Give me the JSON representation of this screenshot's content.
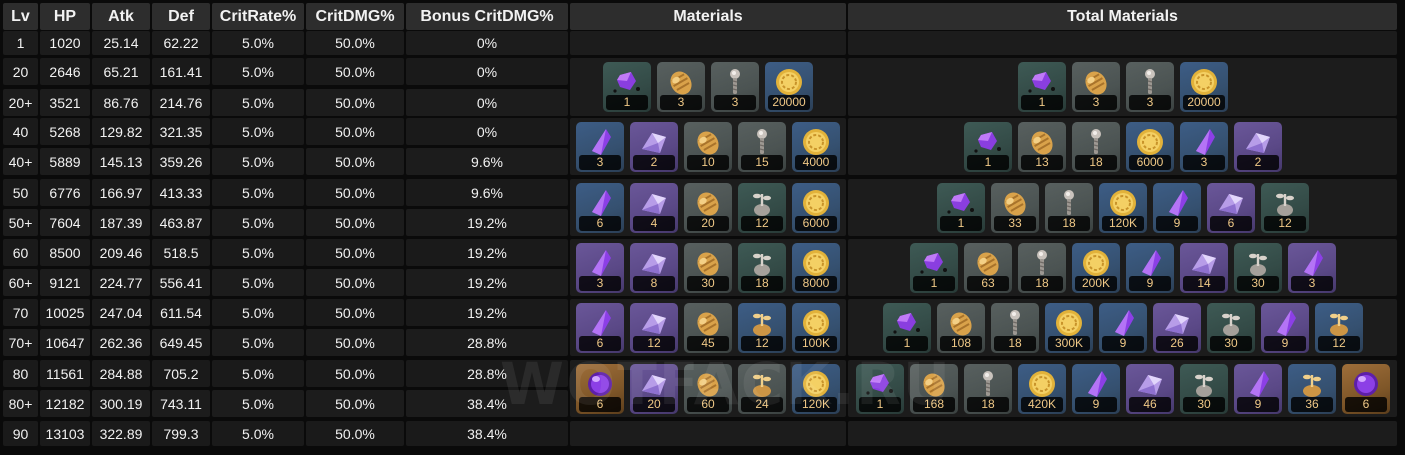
{
  "headers": {
    "lv": "Lv",
    "hp": "HP",
    "atk": "Atk",
    "def": "Def",
    "crit_rate": "CritRate%",
    "crit_dmg": "CritDMG%",
    "bonus_crit_dmg": "Bonus CritDMG%",
    "materials": "Materials",
    "total_materials": "Total Materials"
  },
  "rows": [
    {
      "lv": "1",
      "hp": "1020",
      "atk": "25.14",
      "def": "62.22",
      "crit_rate": "5.0%",
      "crit_dmg": "50.0%",
      "bonus": "0%"
    },
    {
      "lv": "20",
      "hp": "2646",
      "atk": "65.21",
      "def": "161.41",
      "crit_rate": "5.0%",
      "crit_dmg": "50.0%",
      "bonus": "0%"
    },
    {
      "lv": "20+",
      "hp": "3521",
      "atk": "86.76",
      "def": "214.76",
      "crit_rate": "5.0%",
      "crit_dmg": "50.0%",
      "bonus": "0%"
    },
    {
      "lv": "40",
      "hp": "5268",
      "atk": "129.82",
      "def": "321.35",
      "crit_rate": "5.0%",
      "crit_dmg": "50.0%",
      "bonus": "0%"
    },
    {
      "lv": "40+",
      "hp": "5889",
      "atk": "145.13",
      "def": "359.26",
      "crit_rate": "5.0%",
      "crit_dmg": "50.0%",
      "bonus": "9.6%"
    },
    {
      "lv": "50",
      "hp": "6776",
      "atk": "166.97",
      "def": "413.33",
      "crit_rate": "5.0%",
      "crit_dmg": "50.0%",
      "bonus": "9.6%"
    },
    {
      "lv": "50+",
      "hp": "7604",
      "atk": "187.39",
      "def": "463.87",
      "crit_rate": "5.0%",
      "crit_dmg": "50.0%",
      "bonus": "19.2%"
    },
    {
      "lv": "60",
      "hp": "8500",
      "atk": "209.46",
      "def": "518.5",
      "crit_rate": "5.0%",
      "crit_dmg": "50.0%",
      "bonus": "19.2%"
    },
    {
      "lv": "60+",
      "hp": "9121",
      "atk": "224.77",
      "def": "556.41",
      "crit_rate": "5.0%",
      "crit_dmg": "50.0%",
      "bonus": "19.2%"
    },
    {
      "lv": "70",
      "hp": "10025",
      "atk": "247.04",
      "def": "611.54",
      "crit_rate": "5.0%",
      "crit_dmg": "50.0%",
      "bonus": "19.2%"
    },
    {
      "lv": "70+",
      "hp": "10647",
      "atk": "262.36",
      "def": "649.45",
      "crit_rate": "5.0%",
      "crit_dmg": "50.0%",
      "bonus": "28.8%"
    },
    {
      "lv": "80",
      "hp": "11561",
      "atk": "284.88",
      "def": "705.2",
      "crit_rate": "5.0%",
      "crit_dmg": "50.0%",
      "bonus": "28.8%"
    },
    {
      "lv": "80+",
      "hp": "12182",
      "atk": "300.19",
      "def": "743.11",
      "crit_rate": "5.0%",
      "crit_dmg": "50.0%",
      "bonus": "38.4%"
    },
    {
      "lv": "90",
      "hp": "13103",
      "atk": "322.89",
      "def": "799.3",
      "crit_rate": "5.0%",
      "crit_dmg": "50.0%",
      "bonus": "38.4%"
    }
  ],
  "materials": [
    [
      {
        "icon": "purple-crystal-chip-icon",
        "qty": "1",
        "bg": "green"
      },
      {
        "icon": "golden-pine-cone-icon",
        "qty": "3",
        "bg": "grey"
      },
      {
        "icon": "silver-bolt-icon",
        "qty": "3",
        "bg": "grey"
      },
      {
        "icon": "gold-coin-icon",
        "qty": "20000",
        "bg": "blue"
      }
    ],
    [
      {
        "icon": "purple-shard-icon",
        "qty": "3",
        "bg": "blue"
      },
      {
        "icon": "purple-fragment-icon",
        "qty": "2",
        "bg": "purple"
      },
      {
        "icon": "golden-pine-cone-icon",
        "qty": "10",
        "bg": "grey"
      },
      {
        "icon": "silver-bolt-icon",
        "qty": "15",
        "bg": "grey"
      },
      {
        "icon": "gold-coin-icon",
        "qty": "4000",
        "bg": "blue"
      }
    ],
    [
      {
        "icon": "purple-shard-icon",
        "qty": "6",
        "bg": "blue"
      },
      {
        "icon": "purple-fragment-icon",
        "qty": "4",
        "bg": "purple"
      },
      {
        "icon": "golden-pine-cone-icon",
        "qty": "20",
        "bg": "grey"
      },
      {
        "icon": "silver-sprout-icon",
        "qty": "12",
        "bg": "green"
      },
      {
        "icon": "gold-coin-icon",
        "qty": "6000",
        "bg": "blue"
      }
    ],
    [
      {
        "icon": "purple-shard-icon",
        "qty": "3",
        "bg": "purple"
      },
      {
        "icon": "purple-fragment-icon",
        "qty": "8",
        "bg": "purple"
      },
      {
        "icon": "golden-pine-cone-icon",
        "qty": "30",
        "bg": "grey"
      },
      {
        "icon": "silver-sprout-icon",
        "qty": "18",
        "bg": "green"
      },
      {
        "icon": "gold-coin-icon",
        "qty": "8000",
        "bg": "blue"
      }
    ],
    [
      {
        "icon": "purple-shard-icon",
        "qty": "6",
        "bg": "purple"
      },
      {
        "icon": "purple-fragment-icon",
        "qty": "12",
        "bg": "purple"
      },
      {
        "icon": "golden-pine-cone-icon",
        "qty": "45",
        "bg": "grey"
      },
      {
        "icon": "golden-sprout-icon",
        "qty": "12",
        "bg": "blue"
      },
      {
        "icon": "gold-coin-icon",
        "qty": "100K",
        "bg": "blue"
      }
    ],
    [
      {
        "icon": "purple-gem-icon",
        "qty": "6",
        "bg": "orange"
      },
      {
        "icon": "purple-fragment-icon",
        "qty": "20",
        "bg": "purple"
      },
      {
        "icon": "golden-pine-cone-icon",
        "qty": "60",
        "bg": "grey"
      },
      {
        "icon": "golden-sprout-icon",
        "qty": "24",
        "bg": "grey"
      },
      {
        "icon": "gold-coin-icon",
        "qty": "120K",
        "bg": "blue"
      }
    ]
  ],
  "total_materials": [
    [
      {
        "icon": "purple-crystal-chip-icon",
        "qty": "1",
        "bg": "green"
      },
      {
        "icon": "golden-pine-cone-icon",
        "qty": "3",
        "bg": "grey"
      },
      {
        "icon": "silver-bolt-icon",
        "qty": "3",
        "bg": "grey"
      },
      {
        "icon": "gold-coin-icon",
        "qty": "20000",
        "bg": "blue"
      }
    ],
    [
      {
        "icon": "purple-crystal-chip-icon",
        "qty": "1",
        "bg": "green"
      },
      {
        "icon": "golden-pine-cone-icon",
        "qty": "13",
        "bg": "grey"
      },
      {
        "icon": "silver-bolt-icon",
        "qty": "18",
        "bg": "grey"
      },
      {
        "icon": "gold-coin-icon",
        "qty": "6000",
        "bg": "blue"
      },
      {
        "icon": "purple-shard-icon",
        "qty": "3",
        "bg": "blue"
      },
      {
        "icon": "purple-fragment-icon",
        "qty": "2",
        "bg": "purple"
      }
    ],
    [
      {
        "icon": "purple-crystal-chip-icon",
        "qty": "1",
        "bg": "green"
      },
      {
        "icon": "golden-pine-cone-icon",
        "qty": "33",
        "bg": "grey"
      },
      {
        "icon": "silver-bolt-icon",
        "qty": "18",
        "bg": "grey"
      },
      {
        "icon": "gold-coin-icon",
        "qty": "120K",
        "bg": "blue"
      },
      {
        "icon": "purple-shard-icon",
        "qty": "9",
        "bg": "blue"
      },
      {
        "icon": "purple-fragment-icon",
        "qty": "6",
        "bg": "purple"
      },
      {
        "icon": "silver-sprout-icon",
        "qty": "12",
        "bg": "green"
      }
    ],
    [
      {
        "icon": "purple-crystal-chip-icon",
        "qty": "1",
        "bg": "green"
      },
      {
        "icon": "golden-pine-cone-icon",
        "qty": "63",
        "bg": "grey"
      },
      {
        "icon": "silver-bolt-icon",
        "qty": "18",
        "bg": "grey"
      },
      {
        "icon": "gold-coin-icon",
        "qty": "200K",
        "bg": "blue"
      },
      {
        "icon": "purple-shard-icon",
        "qty": "9",
        "bg": "blue"
      },
      {
        "icon": "purple-fragment-icon",
        "qty": "14",
        "bg": "purple"
      },
      {
        "icon": "silver-sprout-icon",
        "qty": "30",
        "bg": "green"
      },
      {
        "icon": "purple-shard-icon",
        "qty": "3",
        "bg": "purple"
      }
    ],
    [
      {
        "icon": "purple-crystal-chip-icon",
        "qty": "1",
        "bg": "green"
      },
      {
        "icon": "golden-pine-cone-icon",
        "qty": "108",
        "bg": "grey"
      },
      {
        "icon": "silver-bolt-icon",
        "qty": "18",
        "bg": "grey"
      },
      {
        "icon": "gold-coin-icon",
        "qty": "300K",
        "bg": "blue"
      },
      {
        "icon": "purple-shard-icon",
        "qty": "9",
        "bg": "blue"
      },
      {
        "icon": "purple-fragment-icon",
        "qty": "26",
        "bg": "purple"
      },
      {
        "icon": "silver-sprout-icon",
        "qty": "30",
        "bg": "green"
      },
      {
        "icon": "purple-shard-icon",
        "qty": "9",
        "bg": "purple"
      },
      {
        "icon": "golden-sprout-icon",
        "qty": "12",
        "bg": "blue"
      }
    ],
    [
      {
        "icon": "purple-crystal-chip-icon",
        "qty": "1",
        "bg": "green"
      },
      {
        "icon": "golden-pine-cone-icon",
        "qty": "168",
        "bg": "grey"
      },
      {
        "icon": "silver-bolt-icon",
        "qty": "18",
        "bg": "grey"
      },
      {
        "icon": "gold-coin-icon",
        "qty": "420K",
        "bg": "blue"
      },
      {
        "icon": "purple-shard-icon",
        "qty": "9",
        "bg": "blue"
      },
      {
        "icon": "purple-fragment-icon",
        "qty": "46",
        "bg": "purple"
      },
      {
        "icon": "silver-sprout-icon",
        "qty": "30",
        "bg": "green"
      },
      {
        "icon": "purple-shard-icon",
        "qty": "9",
        "bg": "purple"
      },
      {
        "icon": "golden-sprout-icon",
        "qty": "36",
        "bg": "blue"
      },
      {
        "icon": "purple-gem-icon",
        "qty": "6",
        "bg": "orange"
      }
    ]
  ],
  "watermark": "WOTFACK.RU",
  "colors": {
    "background": "#0a0a0a",
    "cell": "#1c1c1c",
    "header": "#2d2d2d",
    "quantity_text": "#f0c987"
  }
}
